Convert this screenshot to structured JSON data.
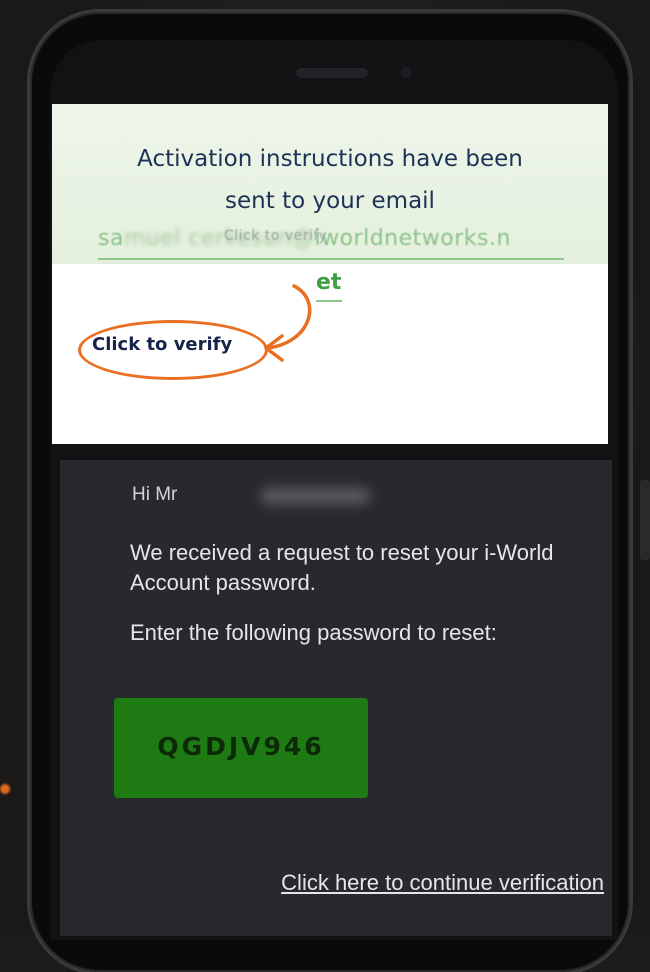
{
  "activation": {
    "title": "Activation instructions have been\nsent to your email",
    "email_start": "sa",
    "email_middle": "muel cerkesun@",
    "email_end": "iworldnetworks.n",
    "email_overlay": "Click to verify",
    "email_tail": "et",
    "verify_label": "Click to verify"
  },
  "email_body": {
    "greeting": "Hi Mr",
    "reset_message": "We received a request to reset your i-World Account password.",
    "reset_instruction": "Enter the following password to reset:",
    "code": "QGDJV946",
    "continue_link": "Click here to continue verification"
  },
  "colors": {
    "accent_orange": "#e96f22",
    "code_green": "#1e7a12",
    "email_green": "#8cc28a",
    "dark_panel": "#28292d"
  },
  "icons": [
    "curved-arrow-icon"
  ]
}
